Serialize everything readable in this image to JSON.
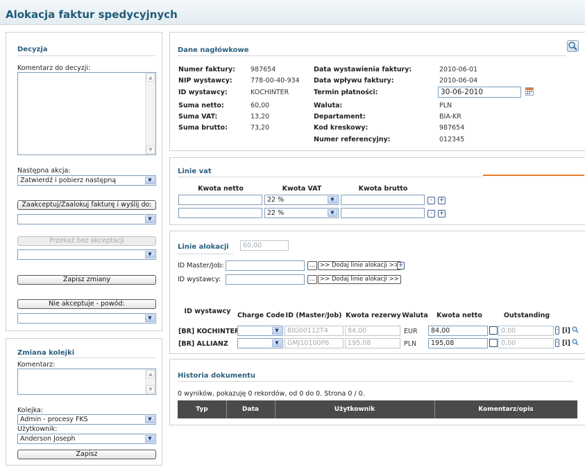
{
  "title": "Alokacja faktur spedycyjnych",
  "decision": {
    "section_title": "Decyzja",
    "comment_label": "Komentarz do decyzji:",
    "next_action_label": "Następna akcja:",
    "next_action_value": "Zatwierdź i pobierz następną",
    "accept_button": "Zaakceptuj/Zaalokuj fakturę i wyślij do:",
    "pass_button": "Przekaż bez akceptacji",
    "save_button": "Zapisz zmiany",
    "reject_button": "Nie akceptuje - powód:"
  },
  "queue": {
    "section_title": "Zmiana kolejki",
    "comment_label": "Komentarz:",
    "queue_label": "Kolejka:",
    "queue_value": "Admin - procesy FKS",
    "user_label": "Użytkownik:",
    "user_value": "Anderson Joseph",
    "save_button": "Zapisz"
  },
  "header": {
    "section_title": "Dane nagłówkowe",
    "left": [
      {
        "label": "Numer faktury:",
        "value": "987654"
      },
      {
        "label": "NIP wystawcy:",
        "value": "778-00-40-934"
      },
      {
        "label": "ID wystawcy:",
        "value": "KOCHINTER"
      },
      {
        "label": "Suma netto:",
        "value": "60,00"
      },
      {
        "label": "Suma VAT:",
        "value": "13,20"
      },
      {
        "label": "Suma brutto:",
        "value": "73,20"
      }
    ],
    "right": [
      {
        "label": "Data wystawienia faktury:",
        "value": "2010-06-01"
      },
      {
        "label": "Data wpływu faktury:",
        "value": "2010-06-04"
      },
      {
        "label": "Termin płatności:",
        "value": "30-06-2010"
      },
      {
        "label": "Waluta:",
        "value": "PLN"
      },
      {
        "label": "Departament:",
        "value": "BIA-KR"
      },
      {
        "label": "Kod kreskowy:",
        "value": "987654"
      },
      {
        "label": "Numer referencyjny:",
        "value": "012345"
      }
    ]
  },
  "vat": {
    "section_title": "Linie vat",
    "col_net": "Kwota netto",
    "col_vat": "Kwota VAT",
    "col_gross": "Kwota brutto",
    "rows": [
      {
        "vat": "22 %"
      },
      {
        "vat": "22 %"
      }
    ],
    "minus": "-",
    "plus": "+"
  },
  "alloc": {
    "section_title": "Linie alokacji",
    "total": "60,00",
    "master_label": "ID Master/Job:",
    "issuer_label": "ID wystawcy:",
    "dots": "...",
    "add_button": ">> Dodaj linie alokacji >>",
    "plus": "+",
    "col_issuer": "ID wystawcy",
    "col_charge": "Charge Code",
    "col_master": "ID (Master/Job)",
    "col_reserve": "Kwota rezerwy",
    "col_currency": "Waluta",
    "col_net": "Kwota netto",
    "col_outstanding": "Outstanding",
    "info": "[i]",
    "rows": [
      {
        "issuer": "[BR] KOCHINTER",
        "master": "BIG00112T4",
        "reserve": "84,00",
        "currency": "EUR",
        "net": "84,00",
        "outstanding": "0,00"
      },
      {
        "issuer": "[BR] ALLIANZ",
        "master": "GMJ10100P6",
        "reserve": "195,08",
        "currency": "PLN",
        "net": "195,08",
        "outstanding": "0,00"
      }
    ]
  },
  "history": {
    "section_title": "Historia dokumentu",
    "summary": "0 wyników, pokazuję 0 rekordów, od 0 do 0. Strona 0 / 0.",
    "columns": [
      "Typ",
      "Data",
      "Użytkownik",
      "Komentarz/opis"
    ]
  }
}
